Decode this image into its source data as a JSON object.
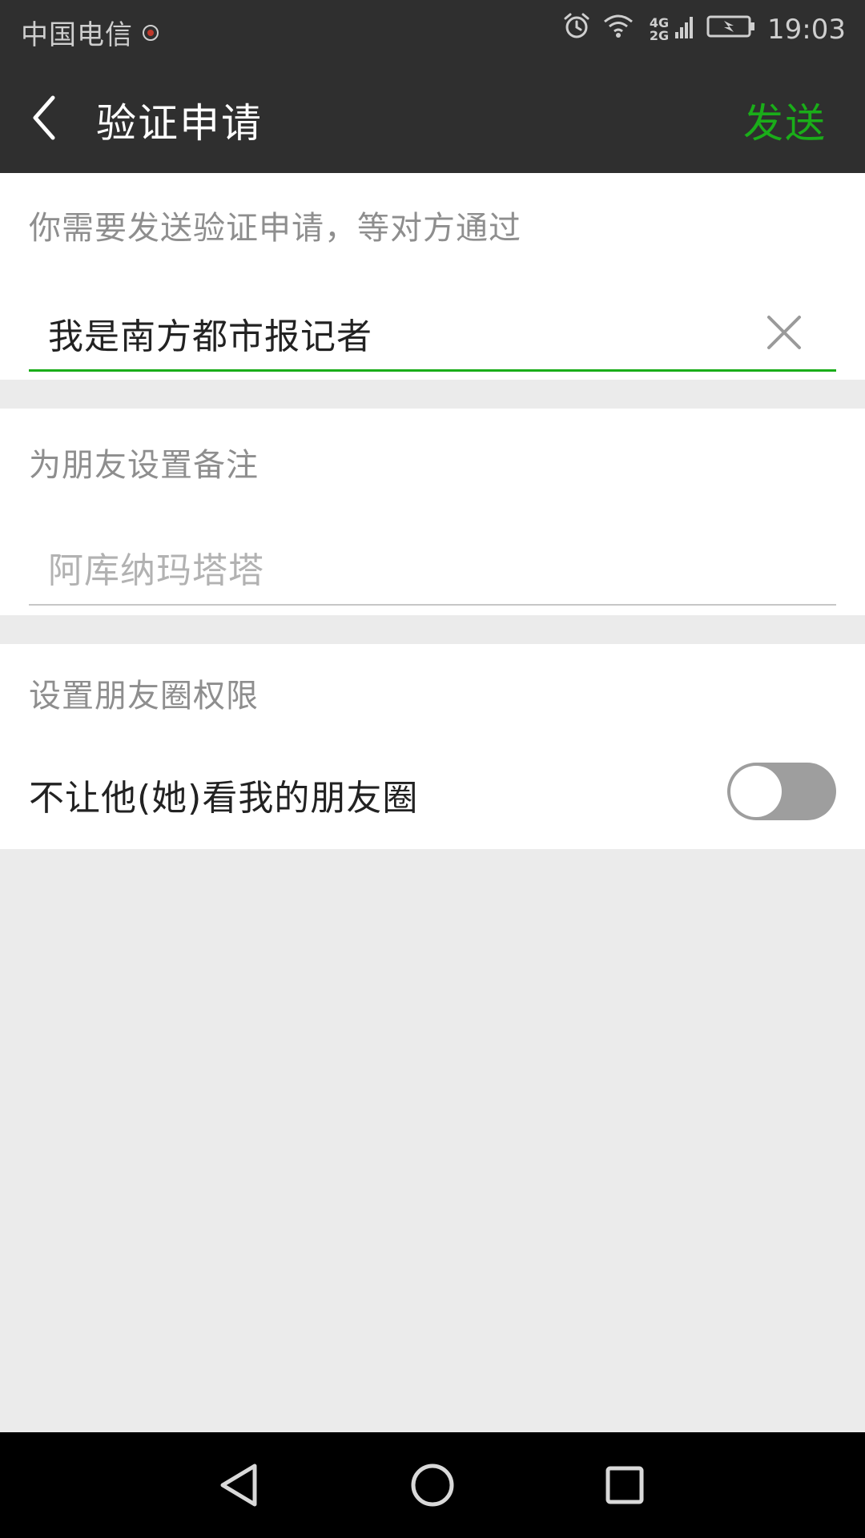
{
  "status_bar": {
    "carrier": "中国电信",
    "network_top": "4G",
    "network_bottom": "2G",
    "time": "19:03",
    "icons": [
      "carrier-badge-icon",
      "alarm-icon",
      "wifi-icon",
      "cell-signal-icon",
      "battery-charging-icon"
    ]
  },
  "title_bar": {
    "title": "验证申请",
    "send_label": "发送",
    "back_icon": "chevron-left-icon"
  },
  "verification": {
    "hint": "你需要发送验证申请，等对方通过",
    "message_value": "我是南方都市报记者",
    "clear_icon": "close-icon"
  },
  "remark": {
    "hint": "为朋友设置备注",
    "placeholder": "阿库纳玛塔塔"
  },
  "moments": {
    "hint": "设置朋友圈权限",
    "toggle_label": "不让他(她)看我的朋友圈",
    "toggle_on": false
  },
  "nav_bar": {
    "icons": [
      "nav-back-icon",
      "nav-home-icon",
      "nav-recent-icon"
    ]
  },
  "colors": {
    "accent_green": "#1aad19",
    "header_bg": "#2f2f2f",
    "page_bg": "#ebebeb"
  }
}
